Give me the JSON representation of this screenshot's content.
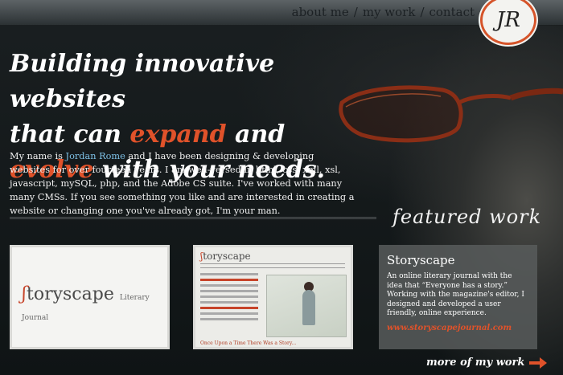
{
  "nav": {
    "items": [
      "about me",
      "my work",
      "contact"
    ],
    "separator": "/",
    "logo_text": "JR"
  },
  "hero": {
    "line1": "Building innovative websites",
    "line2_pre": "that can ",
    "line2_hl": "expand",
    "line2_post": " and",
    "line3_hl": "evolve",
    "line3_post": " with your needs."
  },
  "intro": {
    "pre": "My name is ",
    "name": "Jordan Rome",
    "post": " and I have been designing & developing websites for over fourteen years. I am well-versed in html, css, xml, xsl, javascript, mySQL, php, and the Adobe CS suite. I've worked with many many CMSs. If you see something you like and are interested in creating a website or changing one you've already got, I'm your man."
  },
  "featured": {
    "heading": "featured work",
    "thumb1": {
      "brand_s": "ʃ",
      "brand_rest": "toryscape",
      "brand_small": "Literary Journal"
    },
    "thumb2": {
      "brand_s": "ʃ",
      "brand_rest": "toryscape",
      "caption": "Once Upon a Time There Was a Story..."
    },
    "panel": {
      "title": "Storyscape",
      "text": "An online literary journal with the idea that “Everyone has a story.” Working with the magazine's editor, I designed and developed a user friendly, online experience.",
      "link": "www.storyscapejournal.com"
    },
    "more": "more of my work"
  },
  "colors": {
    "accent": "#e0522a",
    "link_blue": "#7ec0e6",
    "panel": "#585c5c"
  }
}
